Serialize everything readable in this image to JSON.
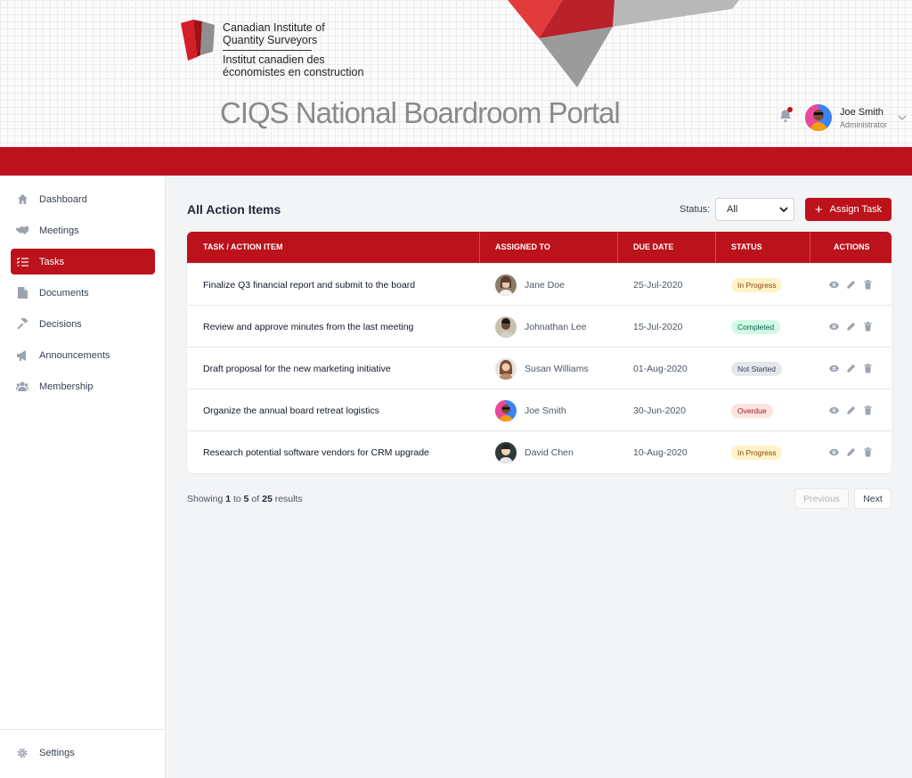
{
  "header": {
    "org_name_en_line1": "Canadian Institute of",
    "org_name_en_line2": "Quantity Surveyors",
    "org_name_fr_line1": "Institut canadien des",
    "org_name_fr_line2": "économistes en construction",
    "portal_title": "CIQS National Boardroom Portal",
    "user": {
      "name": "Joe Smith",
      "role": "Administrator"
    },
    "icons": {
      "notifications": "bell-icon",
      "menu": "chevron-down-icon"
    }
  },
  "sidebar": {
    "items": [
      {
        "label": "Dashboard",
        "icon": "home-icon",
        "active": false
      },
      {
        "label": "Meetings",
        "icon": "handshake-icon",
        "active": false
      },
      {
        "label": "Tasks",
        "icon": "tasks-icon",
        "active": true
      },
      {
        "label": "Documents",
        "icon": "document-icon",
        "active": false
      },
      {
        "label": "Decisions",
        "icon": "gavel-icon",
        "active": false
      },
      {
        "label": "Announcements",
        "icon": "megaphone-icon",
        "active": false
      },
      {
        "label": "Membership",
        "icon": "users-icon",
        "active": false
      }
    ],
    "settings_label": "Settings"
  },
  "main": {
    "title": "All Action Items",
    "status_filter": {
      "label": "Status:",
      "value": "All"
    },
    "assign_button": "Assign Task",
    "columns": [
      "TASK / ACTION ITEM",
      "ASSIGNED TO",
      "DUE DATE",
      "STATUS",
      "ACTIONS"
    ],
    "rows": [
      {
        "task": "Finalize Q3 financial report and submit to the board",
        "assignee": "Jane Doe",
        "due": "25-Jul-2020",
        "status": "In Progress"
      },
      {
        "task": "Review and approve minutes from the last meeting",
        "assignee": "Johnathan Lee",
        "due": "15-Jul-2020",
        "status": "Completed"
      },
      {
        "task": "Draft proposal for the new marketing initiative",
        "assignee": "Susan Williams",
        "due": "01-Aug-2020",
        "status": "Not Started"
      },
      {
        "task": "Organize the annual board retreat logistics",
        "assignee": "Joe Smith",
        "due": "30-Jun-2020",
        "status": "Overdue"
      },
      {
        "task": "Research potential software vendors for CRM upgrade",
        "assignee": "David Chen",
        "due": "10-Aug-2020",
        "status": "In Progress"
      }
    ],
    "status_colors": {
      "In Progress": {
        "bg": "#fef3c7",
        "fg": "#92400e"
      },
      "Completed": {
        "bg": "#d1fae5",
        "fg": "#065f46"
      },
      "Not Started": {
        "bg": "#e5e7eb",
        "fg": "#374151"
      },
      "Overdue": {
        "bg": "#fee2e2",
        "fg": "#991b1b"
      }
    },
    "pagination": {
      "showing_prefix": "Showing",
      "from": "1",
      "to_word": "to",
      "to": "5",
      "of_word": "of",
      "total": "25",
      "results_word": "results",
      "previous": "Previous",
      "next": "Next"
    }
  },
  "colors": {
    "brand_red": "#bb121b",
    "background": "#f3f4f6"
  }
}
